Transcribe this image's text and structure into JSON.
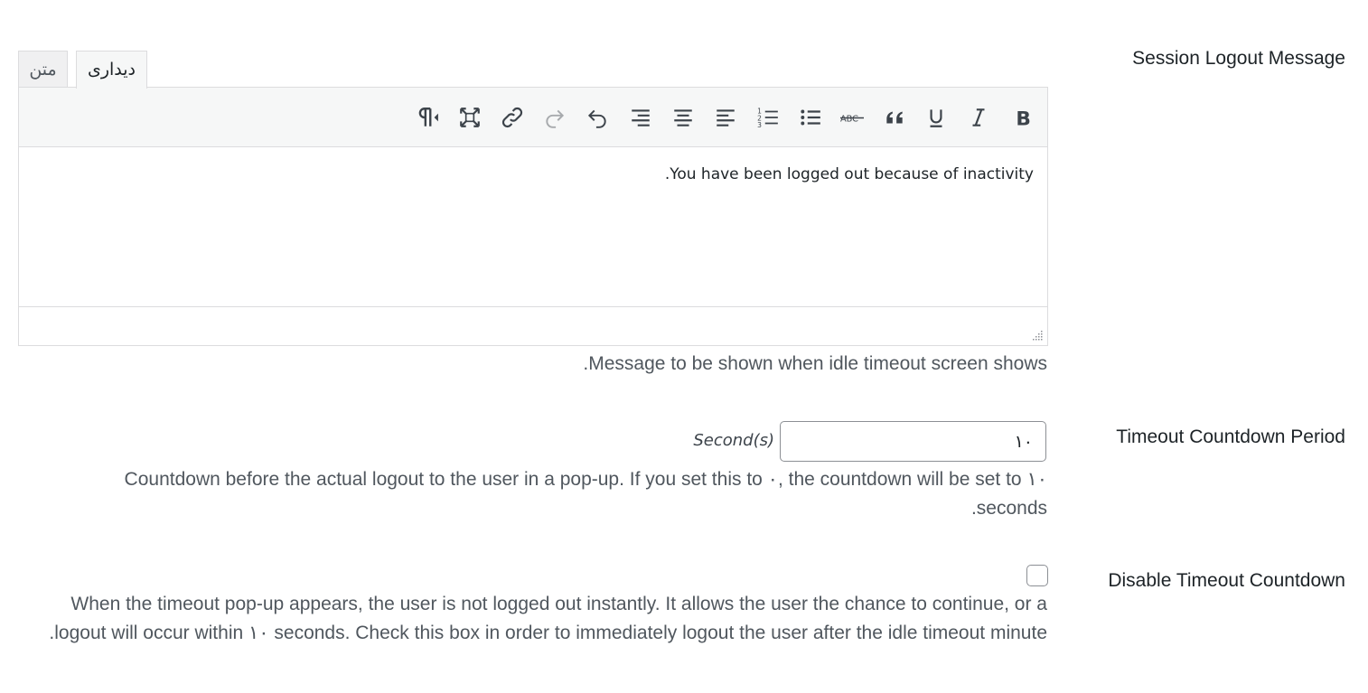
{
  "session_logout": {
    "label": "Session Logout Message",
    "tabs": {
      "visual": "دیداری",
      "text": "متن"
    },
    "toolbar": [
      {
        "name": "bold-icon",
        "glyph": "B"
      },
      {
        "name": "italic-icon",
        "glyph": "I"
      },
      {
        "name": "underline-icon",
        "glyph": "U"
      },
      {
        "name": "blockquote-icon",
        "glyph": "quote"
      },
      {
        "name": "strikethrough-icon",
        "glyph": "ABC"
      },
      {
        "name": "bulleted-list-icon",
        "glyph": "ul"
      },
      {
        "name": "numbered-list-icon",
        "glyph": "ol"
      },
      {
        "name": "align-left-icon",
        "glyph": "left"
      },
      {
        "name": "align-center-icon",
        "glyph": "center"
      },
      {
        "name": "align-right-icon",
        "glyph": "right"
      },
      {
        "name": "undo-icon",
        "glyph": "undo"
      },
      {
        "name": "redo-icon",
        "glyph": "redo"
      },
      {
        "name": "link-icon",
        "glyph": "link"
      },
      {
        "name": "fullscreen-icon",
        "glyph": "fullscreen"
      },
      {
        "name": "text-direction-icon",
        "glyph": "rtl"
      }
    ],
    "content": "You have been logged out because of inactivity.",
    "description": "Message to be shown when idle timeout screen shows."
  },
  "timeout_countdown": {
    "label": "Timeout Countdown Period",
    "value": "۱۰",
    "unit": "Second(s)",
    "description": "Countdown before the actual logout to the user in a pop-up. If you set this to ۰, the countdown will be set to ۱۰ seconds."
  },
  "disable_countdown": {
    "label": "Disable Timeout Countdown",
    "checked": false,
    "description": "When the timeout pop-up appears, the user is not logged out instantly. It allows the user the chance to continue, or a logout will occur within ۱۰ seconds. Check this box in order to immediately logout the user after the idle timeout minute."
  }
}
